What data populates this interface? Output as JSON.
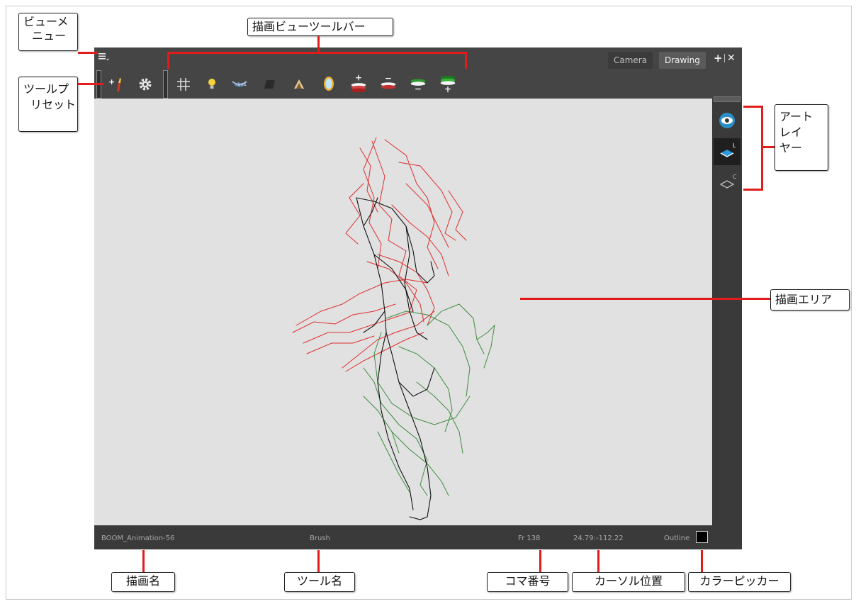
{
  "window": {
    "tabs": [
      {
        "label": "Camera",
        "active": false
      },
      {
        "label": "Drawing",
        "active": true
      }
    ],
    "add_tab_icon": "plus-icon",
    "close_icon": "close-icon"
  },
  "toolbar": {
    "left_tools": [
      "tool-preset-add-icon",
      "gear-icon"
    ],
    "view_tools": [
      "grid-icon",
      "light-table-icon",
      "onion-skin-icon",
      "shade-icon",
      "fill-icon",
      "mirror-icon",
      "add-previous-drawing-icon",
      "remove-previous-drawing-icon",
      "remove-next-drawing-icon",
      "add-next-drawing-icon"
    ]
  },
  "layers": {
    "items": [
      {
        "name": "eye-icon",
        "active": false
      },
      {
        "name": "line-art-layer-icon",
        "badge": "L",
        "active": true
      },
      {
        "name": "color-art-layer-icon",
        "badge": "C",
        "active": false
      }
    ]
  },
  "status": {
    "drawing_name": "BOOM_Animation-56",
    "tool_name": "Brush",
    "frame": "Fr 138",
    "cursor": "24.79:-112.22",
    "art_mode": "Outline",
    "current_color": "#000000"
  },
  "annotations": {
    "view_menu": [
      "ビューメ",
      "ニュー"
    ],
    "drawing_toolbar": "描画ビューツールバー",
    "tool_presets": [
      "ツールプ",
      "リセット"
    ],
    "art_layer": [
      "アート",
      "レイ",
      "ヤー"
    ],
    "drawing_area": "描画エリア",
    "drawing_name": "描画名",
    "tool_name": "ツール名",
    "frame_number": "コマ番号",
    "cursor_position": "カーソル位置",
    "color_picker": "カラーピッカー"
  },
  "colors": {
    "accent_red": "#e21b1b",
    "line_art": "#dd3030",
    "color_art": "#3a8a3a",
    "canvas": "#e1e1e1"
  }
}
